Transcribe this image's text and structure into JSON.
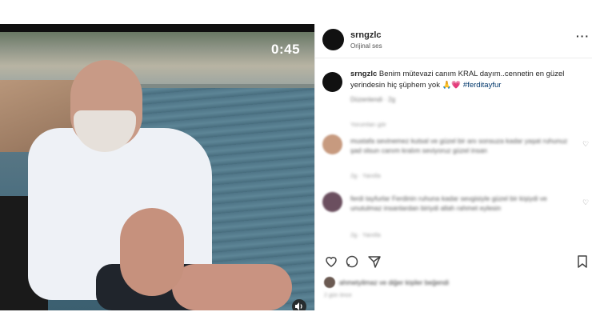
{
  "video": {
    "duration_label": "0:45",
    "volume_icon": "speaker-icon"
  },
  "post": {
    "username": "srngzlc",
    "audio_label": "Orijinal ses",
    "more_icon": "more-options-icon",
    "caption": {
      "username": "srngzlc",
      "text": "Benim mütevazi canım KRAL dayım..cennetin en güzel yerindesin hiç şüphem yok 🙏💗",
      "hashtag": "#ferditayfur",
      "meta": "Düzenlendi · 2g"
    },
    "comments_section_label": "Yorumları gör",
    "comments": [
      {
        "text": "mustafa sevinemez kutsal ve güzel bir anı sonsuza kadar yaşat ruhunuz şad olsun canım kralım seviyoruz güzel insan",
        "meta": "2g · Yanıtla"
      },
      {
        "text": "ferdi tayfurlar Ferdinin ruhuna kadar sevgisiyle güzel bir kişiydi ve unutulmaz insanlardan biriydi allah rahmet eylesin",
        "meta": "2g · Yanıtla"
      }
    ],
    "likes_text": "ahmetyilmaz ve diğer kişiler beğendi",
    "time_ago": "2 gün önce"
  },
  "colors": {
    "text": "#262626",
    "hashtag": "#00376b",
    "avatar": "#111111",
    "heart_emoji": "#e0245e"
  }
}
